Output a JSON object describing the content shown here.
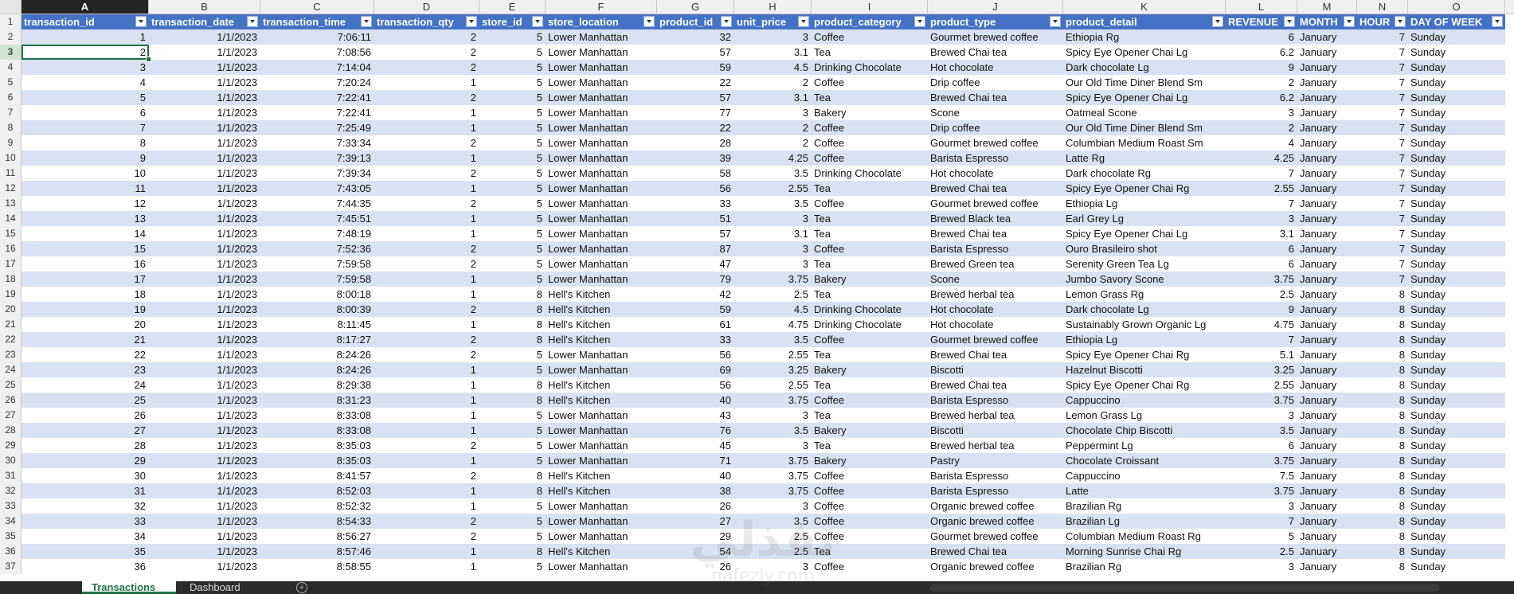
{
  "columns": [
    {
      "letter": "A",
      "header": "transaction_id",
      "width": 160,
      "align": "r"
    },
    {
      "letter": "B",
      "header": "transaction_date",
      "width": 140,
      "align": "r"
    },
    {
      "letter": "C",
      "header": "transaction_time",
      "width": 143,
      "align": "r"
    },
    {
      "letter": "D",
      "header": "transaction_qty",
      "width": 132,
      "align": "r"
    },
    {
      "letter": "E",
      "header": "store_id",
      "width": 83,
      "align": "r"
    },
    {
      "letter": "F",
      "header": "store_location",
      "width": 140,
      "align": "l"
    },
    {
      "letter": "G",
      "header": "product_id",
      "width": 97,
      "align": "r"
    },
    {
      "letter": "H",
      "header": "unit_price",
      "width": 97,
      "align": "r"
    },
    {
      "letter": "I",
      "header": "product_category",
      "width": 146,
      "align": "l"
    },
    {
      "letter": "J",
      "header": "product_type",
      "width": 170,
      "align": "l"
    },
    {
      "letter": "K",
      "header": "product_detail",
      "width": 204,
      "align": "l"
    },
    {
      "letter": "L",
      "header": "REVENUE",
      "width": 90,
      "align": "r"
    },
    {
      "letter": "M",
      "header": "MONTH",
      "width": 75,
      "align": "l"
    },
    {
      "letter": "N",
      "header": "HOUR",
      "width": 64,
      "align": "r"
    },
    {
      "letter": "O",
      "header": "DAY OF WEEK",
      "width": 122,
      "align": "l"
    }
  ],
  "rows": [
    [
      "1",
      "1/1/2023",
      "7:06:11",
      "2",
      "5",
      "Lower Manhattan",
      "32",
      "3",
      "Coffee",
      "Gourmet brewed coffee",
      "Ethiopia Rg",
      "6",
      "January",
      "7",
      "Sunday"
    ],
    [
      "2",
      "1/1/2023",
      "7:08:56",
      "2",
      "5",
      "Lower Manhattan",
      "57",
      "3.1",
      "Tea",
      "Brewed Chai tea",
      "Spicy Eye Opener Chai Lg",
      "6.2",
      "January",
      "7",
      "Sunday"
    ],
    [
      "3",
      "1/1/2023",
      "7:14:04",
      "2",
      "5",
      "Lower Manhattan",
      "59",
      "4.5",
      "Drinking Chocolate",
      "Hot chocolate",
      "Dark chocolate Lg",
      "9",
      "January",
      "7",
      "Sunday"
    ],
    [
      "4",
      "1/1/2023",
      "7:20:24",
      "1",
      "5",
      "Lower Manhattan",
      "22",
      "2",
      "Coffee",
      "Drip coffee",
      "Our Old Time Diner Blend Sm",
      "2",
      "January",
      "7",
      "Sunday"
    ],
    [
      "5",
      "1/1/2023",
      "7:22:41",
      "2",
      "5",
      "Lower Manhattan",
      "57",
      "3.1",
      "Tea",
      "Brewed Chai tea",
      "Spicy Eye Opener Chai Lg",
      "6.2",
      "January",
      "7",
      "Sunday"
    ],
    [
      "6",
      "1/1/2023",
      "7:22:41",
      "1",
      "5",
      "Lower Manhattan",
      "77",
      "3",
      "Bakery",
      "Scone",
      "Oatmeal Scone",
      "3",
      "January",
      "7",
      "Sunday"
    ],
    [
      "7",
      "1/1/2023",
      "7:25:49",
      "1",
      "5",
      "Lower Manhattan",
      "22",
      "2",
      "Coffee",
      "Drip coffee",
      "Our Old Time Diner Blend Sm",
      "2",
      "January",
      "7",
      "Sunday"
    ],
    [
      "8",
      "1/1/2023",
      "7:33:34",
      "2",
      "5",
      "Lower Manhattan",
      "28",
      "2",
      "Coffee",
      "Gourmet brewed coffee",
      "Columbian Medium Roast Sm",
      "4",
      "January",
      "7",
      "Sunday"
    ],
    [
      "9",
      "1/1/2023",
      "7:39:13",
      "1",
      "5",
      "Lower Manhattan",
      "39",
      "4.25",
      "Coffee",
      "Barista Espresso",
      "Latte Rg",
      "4.25",
      "January",
      "7",
      "Sunday"
    ],
    [
      "10",
      "1/1/2023",
      "7:39:34",
      "2",
      "5",
      "Lower Manhattan",
      "58",
      "3.5",
      "Drinking Chocolate",
      "Hot chocolate",
      "Dark chocolate Rg",
      "7",
      "January",
      "7",
      "Sunday"
    ],
    [
      "11",
      "1/1/2023",
      "7:43:05",
      "1",
      "5",
      "Lower Manhattan",
      "56",
      "2.55",
      "Tea",
      "Brewed Chai tea",
      "Spicy Eye Opener Chai Rg",
      "2.55",
      "January",
      "7",
      "Sunday"
    ],
    [
      "12",
      "1/1/2023",
      "7:44:35",
      "2",
      "5",
      "Lower Manhattan",
      "33",
      "3.5",
      "Coffee",
      "Gourmet brewed coffee",
      "Ethiopia Lg",
      "7",
      "January",
      "7",
      "Sunday"
    ],
    [
      "13",
      "1/1/2023",
      "7:45:51",
      "1",
      "5",
      "Lower Manhattan",
      "51",
      "3",
      "Tea",
      "Brewed Black tea",
      "Earl Grey Lg",
      "3",
      "January",
      "7",
      "Sunday"
    ],
    [
      "14",
      "1/1/2023",
      "7:48:19",
      "1",
      "5",
      "Lower Manhattan",
      "57",
      "3.1",
      "Tea",
      "Brewed Chai tea",
      "Spicy Eye Opener Chai Lg",
      "3.1",
      "January",
      "7",
      "Sunday"
    ],
    [
      "15",
      "1/1/2023",
      "7:52:36",
      "2",
      "5",
      "Lower Manhattan",
      "87",
      "3",
      "Coffee",
      "Barista Espresso",
      "Ouro Brasileiro shot",
      "6",
      "January",
      "7",
      "Sunday"
    ],
    [
      "16",
      "1/1/2023",
      "7:59:58",
      "2",
      "5",
      "Lower Manhattan",
      "47",
      "3",
      "Tea",
      "Brewed Green tea",
      "Serenity Green Tea Lg",
      "6",
      "January",
      "7",
      "Sunday"
    ],
    [
      "17",
      "1/1/2023",
      "7:59:58",
      "1",
      "5",
      "Lower Manhattan",
      "79",
      "3.75",
      "Bakery",
      "Scone",
      "Jumbo Savory Scone",
      "3.75",
      "January",
      "7",
      "Sunday"
    ],
    [
      "18",
      "1/1/2023",
      "8:00:18",
      "1",
      "8",
      "Hell's Kitchen",
      "42",
      "2.5",
      "Tea",
      "Brewed herbal tea",
      "Lemon Grass Rg",
      "2.5",
      "January",
      "8",
      "Sunday"
    ],
    [
      "19",
      "1/1/2023",
      "8:00:39",
      "2",
      "8",
      "Hell's Kitchen",
      "59",
      "4.5",
      "Drinking Chocolate",
      "Hot chocolate",
      "Dark chocolate Lg",
      "9",
      "January",
      "8",
      "Sunday"
    ],
    [
      "20",
      "1/1/2023",
      "8:11:45",
      "1",
      "8",
      "Hell's Kitchen",
      "61",
      "4.75",
      "Drinking Chocolate",
      "Hot chocolate",
      "Sustainably Grown Organic Lg",
      "4.75",
      "January",
      "8",
      "Sunday"
    ],
    [
      "21",
      "1/1/2023",
      "8:17:27",
      "2",
      "8",
      "Hell's Kitchen",
      "33",
      "3.5",
      "Coffee",
      "Gourmet brewed coffee",
      "Ethiopia Lg",
      "7",
      "January",
      "8",
      "Sunday"
    ],
    [
      "22",
      "1/1/2023",
      "8:24:26",
      "2",
      "5",
      "Lower Manhattan",
      "56",
      "2.55",
      "Tea",
      "Brewed Chai tea",
      "Spicy Eye Opener Chai Rg",
      "5.1",
      "January",
      "8",
      "Sunday"
    ],
    [
      "23",
      "1/1/2023",
      "8:24:26",
      "1",
      "5",
      "Lower Manhattan",
      "69",
      "3.25",
      "Bakery",
      "Biscotti",
      "Hazelnut Biscotti",
      "3.25",
      "January",
      "8",
      "Sunday"
    ],
    [
      "24",
      "1/1/2023",
      "8:29:38",
      "1",
      "8",
      "Hell's Kitchen",
      "56",
      "2.55",
      "Tea",
      "Brewed Chai tea",
      "Spicy Eye Opener Chai Rg",
      "2.55",
      "January",
      "8",
      "Sunday"
    ],
    [
      "25",
      "1/1/2023",
      "8:31:23",
      "1",
      "8",
      "Hell's Kitchen",
      "40",
      "3.75",
      "Coffee",
      "Barista Espresso",
      "Cappuccino",
      "3.75",
      "January",
      "8",
      "Sunday"
    ],
    [
      "26",
      "1/1/2023",
      "8:33:08",
      "1",
      "5",
      "Lower Manhattan",
      "43",
      "3",
      "Tea",
      "Brewed herbal tea",
      "Lemon Grass Lg",
      "3",
      "January",
      "8",
      "Sunday"
    ],
    [
      "27",
      "1/1/2023",
      "8:33:08",
      "1",
      "5",
      "Lower Manhattan",
      "76",
      "3.5",
      "Bakery",
      "Biscotti",
      "Chocolate Chip Biscotti",
      "3.5",
      "January",
      "8",
      "Sunday"
    ],
    [
      "28",
      "1/1/2023",
      "8:35:03",
      "2",
      "5",
      "Lower Manhattan",
      "45",
      "3",
      "Tea",
      "Brewed herbal tea",
      "Peppermint Lg",
      "6",
      "January",
      "8",
      "Sunday"
    ],
    [
      "29",
      "1/1/2023",
      "8:35:03",
      "1",
      "5",
      "Lower Manhattan",
      "71",
      "3.75",
      "Bakery",
      "Pastry",
      "Chocolate Croissant",
      "3.75",
      "January",
      "8",
      "Sunday"
    ],
    [
      "30",
      "1/1/2023",
      "8:41:57",
      "2",
      "8",
      "Hell's Kitchen",
      "40",
      "3.75",
      "Coffee",
      "Barista Espresso",
      "Cappuccino",
      "7.5",
      "January",
      "8",
      "Sunday"
    ],
    [
      "31",
      "1/1/2023",
      "8:52:03",
      "1",
      "8",
      "Hell's Kitchen",
      "38",
      "3.75",
      "Coffee",
      "Barista Espresso",
      "Latte",
      "3.75",
      "January",
      "8",
      "Sunday"
    ],
    [
      "32",
      "1/1/2023",
      "8:52:32",
      "1",
      "5",
      "Lower Manhattan",
      "26",
      "3",
      "Coffee",
      "Organic brewed coffee",
      "Brazilian Rg",
      "3",
      "January",
      "8",
      "Sunday"
    ],
    [
      "33",
      "1/1/2023",
      "8:54:33",
      "2",
      "5",
      "Lower Manhattan",
      "27",
      "3.5",
      "Coffee",
      "Organic brewed coffee",
      "Brazilian Lg",
      "7",
      "January",
      "8",
      "Sunday"
    ],
    [
      "34",
      "1/1/2023",
      "8:56:27",
      "2",
      "5",
      "Lower Manhattan",
      "29",
      "2.5",
      "Coffee",
      "Gourmet brewed coffee",
      "Columbian Medium Roast Rg",
      "5",
      "January",
      "8",
      "Sunday"
    ],
    [
      "35",
      "1/1/2023",
      "8:57:46",
      "1",
      "8",
      "Hell's Kitchen",
      "54",
      "2.5",
      "Tea",
      "Brewed Chai tea",
      "Morning Sunrise Chai Rg",
      "2.5",
      "January",
      "8",
      "Sunday"
    ],
    [
      "36",
      "1/1/2023",
      "8:58:55",
      "1",
      "5",
      "Lower Manhattan",
      "26",
      "3",
      "Coffee",
      "Organic brewed coffee",
      "Brazilian Rg",
      "3",
      "January",
      "8",
      "Sunday"
    ]
  ],
  "tabs": [
    {
      "label": "Transactions",
      "active": true
    },
    {
      "label": "Dashboard",
      "active": false
    }
  ],
  "active_cell": {
    "row": 3,
    "col": "A"
  },
  "watermark_text": "nafezly.com",
  "colors": {
    "header_fill": "#4472c4",
    "band_fill": "#d9e1f2",
    "accent": "#1e7145"
  }
}
